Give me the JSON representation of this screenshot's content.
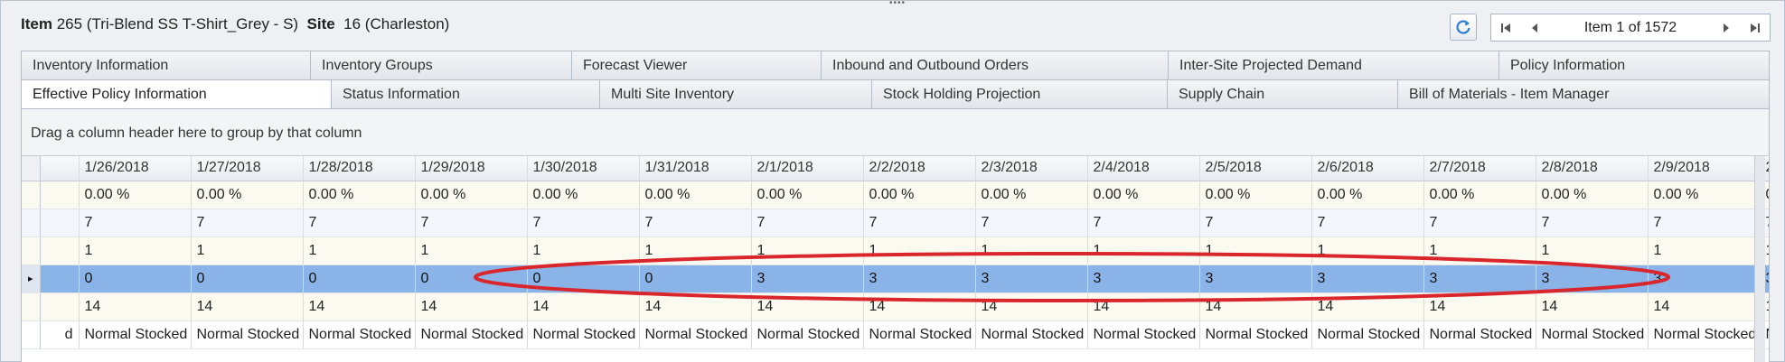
{
  "header": {
    "item_label": "Item",
    "item_value": "265 (Tri-Blend SS T-Shirt_Grey - S)",
    "site_label": "Site",
    "site_value": "16 (Charleston)"
  },
  "navigator": {
    "position_text": "Item 1 of 1572",
    "icons": [
      "refresh-icon",
      "first-record-icon",
      "previous-record-icon",
      "next-record-icon",
      "last-record-icon"
    ]
  },
  "tabs": {
    "row1": [
      "Inventory Information",
      "Inventory Groups",
      "Forecast Viewer",
      "Inbound and Outbound Orders",
      "Inter-Site Projected Demand",
      "Policy Information"
    ],
    "row2": [
      "Effective Policy Information",
      "Status Information",
      "Multi Site Inventory",
      "Stock Holding Projection",
      "Supply Chain",
      "Bill of Materials - Item Manager"
    ],
    "active": "Effective Policy Information"
  },
  "grid": {
    "group_hint": "Drag a column header here to group by that column",
    "columns": [
      "1/26/2018",
      "1/27/2018",
      "1/28/2018",
      "1/29/2018",
      "1/30/2018",
      "1/31/2018",
      "2/1/2018",
      "2/2/2018",
      "2/3/2018",
      "2/4/2018",
      "2/5/2018",
      "2/6/2018",
      "2/7/2018",
      "2/8/2018",
      "2/9/2018",
      "2/"
    ],
    "rows": [
      [
        "0.00 %",
        "0.00 %",
        "0.00 %",
        "0.00 %",
        "0.00 %",
        "0.00 %",
        "0.00 %",
        "0.00 %",
        "0.00 %",
        "0.00 %",
        "0.00 %",
        "0.00 %",
        "0.00 %",
        "0.00 %",
        "0.00 %",
        "0."
      ],
      [
        "7",
        "7",
        "7",
        "7",
        "7",
        "7",
        "7",
        "7",
        "7",
        "7",
        "7",
        "7",
        "7",
        "7",
        "7",
        "7"
      ],
      [
        "1",
        "1",
        "1",
        "1",
        "1",
        "1",
        "1",
        "1",
        "1",
        "1",
        "1",
        "1",
        "1",
        "1",
        "1",
        "1"
      ],
      [
        "0",
        "0",
        "0",
        "0",
        "0",
        "0",
        "3",
        "3",
        "3",
        "3",
        "3",
        "3",
        "3",
        "3",
        "3",
        "3"
      ],
      [
        "14",
        "14",
        "14",
        "14",
        "14",
        "14",
        "14",
        "14",
        "14",
        "14",
        "14",
        "14",
        "14",
        "14",
        "14",
        "14"
      ],
      [
        "Normal Stocked",
        "Normal Stocked",
        "Normal Stocked",
        "Normal Stocked",
        "Normal Stocked",
        "Normal Stocked",
        "Normal Stocked",
        "Normal Stocked",
        "Normal Stocked",
        "Normal Stocked",
        "Normal Stocked",
        "Normal Stocked",
        "Normal Stocked",
        "Normal Stocked",
        "Normal Stocked",
        "No"
      ]
    ],
    "first_col_partial_last_row": "d",
    "selected_row_index": 3,
    "selection_color": "#8ab4e8",
    "annotation_color": "#d9262c"
  }
}
